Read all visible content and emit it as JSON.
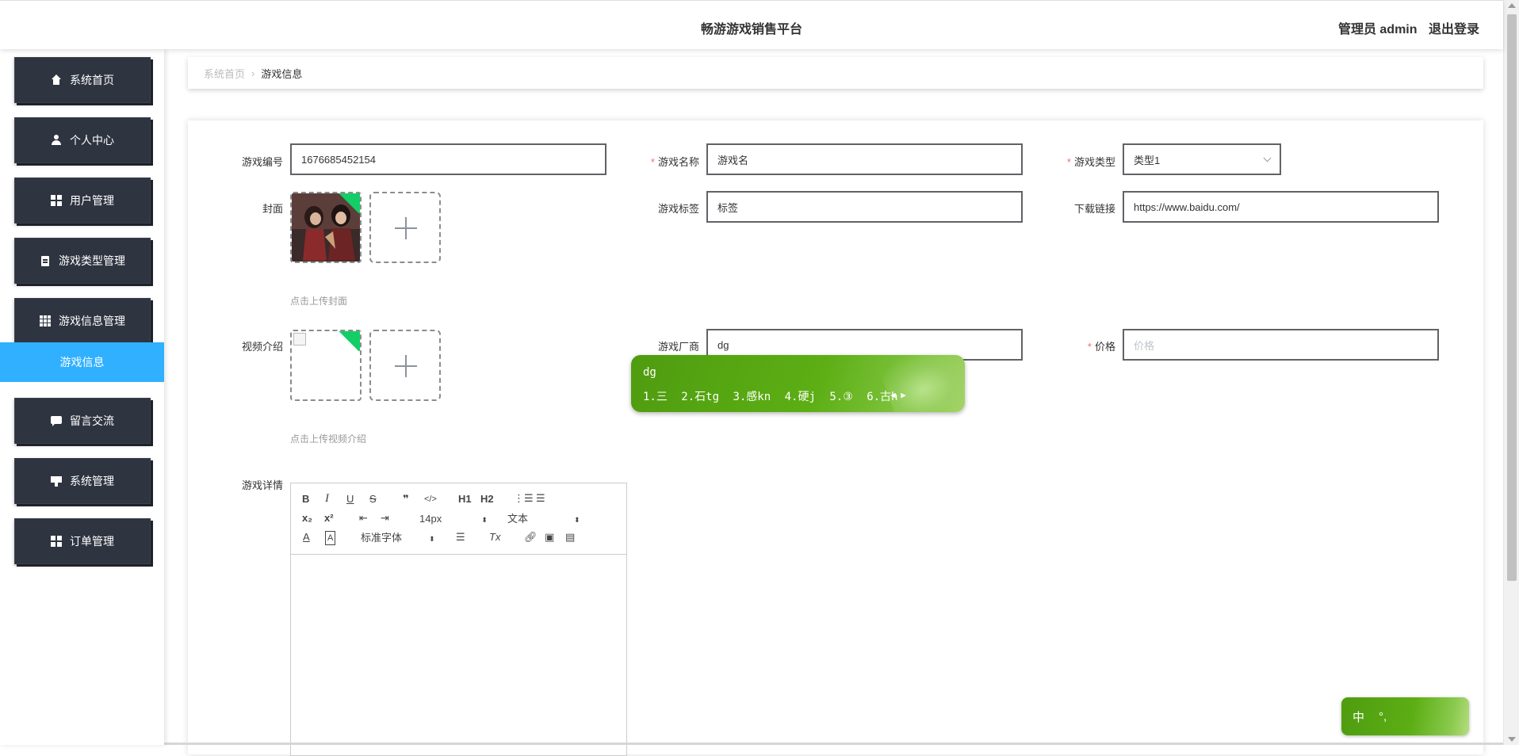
{
  "header": {
    "title": "畅游游戏销售平台",
    "admin_label": "管理员 admin",
    "logout_label": "退出登录"
  },
  "sidebar": {
    "items": [
      {
        "label": "系统首页",
        "icon": "home-icon"
      },
      {
        "label": "个人中心",
        "icon": "user-icon"
      },
      {
        "label": "用户管理",
        "icon": "grid-icon"
      },
      {
        "label": "游戏类型管理",
        "icon": "clipboard-icon"
      },
      {
        "label": "游戏信息管理",
        "icon": "grid9-icon"
      },
      {
        "label": "留言交流",
        "icon": "chat-icon"
      },
      {
        "label": "系统管理",
        "icon": "monitor-icon"
      },
      {
        "label": "订单管理",
        "icon": "grid-icon"
      }
    ],
    "active_subitem": "游戏信息"
  },
  "breadcrumb": {
    "home": "系统首页",
    "separator": "›",
    "current": "游戏信息"
  },
  "form": {
    "game_code": {
      "label": "游戏编号",
      "value": "1676685452154"
    },
    "game_name": {
      "label": "游戏名称",
      "value": "游戏名",
      "required": true
    },
    "game_type": {
      "label": "游戏类型",
      "value": "类型1",
      "required": true
    },
    "cover": {
      "label": "封面",
      "tip": "点击上传封面"
    },
    "game_tags": {
      "label": "游戏标签",
      "value": "标签"
    },
    "download_link": {
      "label": "下载链接",
      "value": "https://www.baidu.com/"
    },
    "video": {
      "label": "视频介绍",
      "tip": "点击上传视频介绍"
    },
    "vendor": {
      "label": "游戏厂商",
      "value": "dg"
    },
    "price": {
      "label": "价格",
      "placeholder": "价格",
      "required": true
    },
    "details": {
      "label": "游戏详情"
    }
  },
  "editor": {
    "font_size": "14px",
    "text_style": "文本",
    "font_family": "标准字体",
    "buttons": [
      "B",
      "I",
      "U",
      "S",
      "❞",
      "</>",
      "H1",
      "H2",
      "x₂",
      "x²"
    ]
  },
  "ime": {
    "composition": "dg",
    "candidates": [
      "1.三",
      "2.石tg",
      "3.感kn",
      "4.硬j",
      "5.③",
      "6.古h"
    ],
    "status_mode": "中",
    "status_punct": "°,"
  },
  "colors": {
    "sidebar_bg": "#2e3440",
    "active_sub": "#30b0ff",
    "ime_green": "#5cae14",
    "required": "#f56c6c",
    "upload_check": "#13ce66"
  }
}
